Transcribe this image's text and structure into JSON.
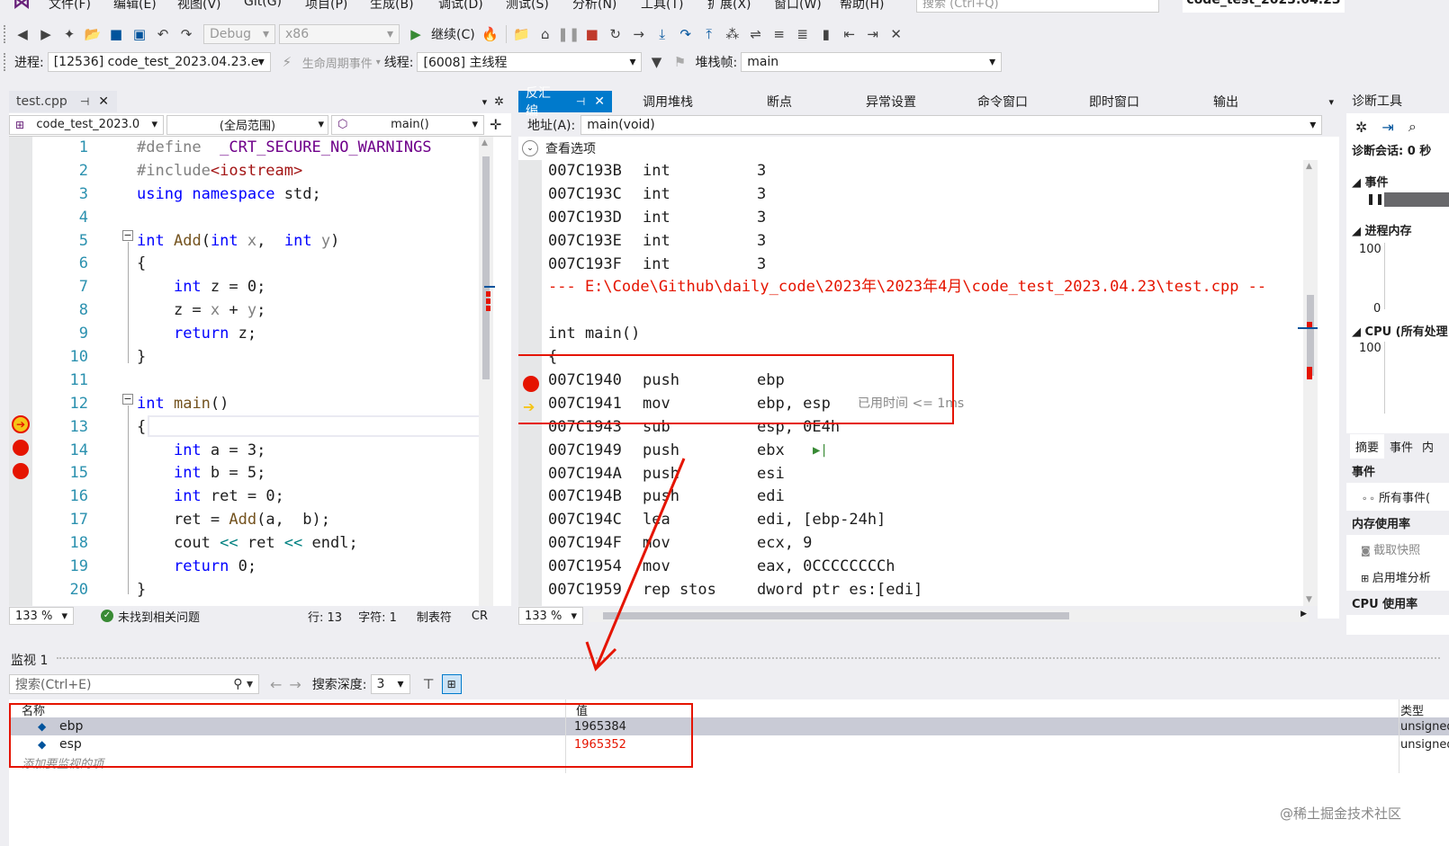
{
  "menubar": {
    "items": [
      "文件(F)",
      "编辑(E)",
      "视图(V)",
      "Git(G)",
      "项目(P)",
      "生成(B)",
      "调试(D)",
      "测试(S)",
      "分析(N)",
      "工具(T)",
      "扩展(X)",
      "窗口(W)",
      "帮助(H)"
    ],
    "search_placeholder": "搜索 (Ctrl+Q)",
    "window_title": "code_test_2023.04.23"
  },
  "toolbar1": {
    "config": "Debug",
    "platform": "x86",
    "continue_label": "继续(C)"
  },
  "toolbar2": {
    "process_label": "进程:",
    "process_value": "[12536] code_test_2023.04.23.e",
    "lifecycle_label": "生命周期事件",
    "thread_label": "线程:",
    "thread_value": "[6008] 主线程",
    "stackframe_label": "堆栈帧:",
    "stackframe_value": "main"
  },
  "editor": {
    "tab_label": "test.cpp",
    "project_combo": "code_test_2023.0",
    "scope_combo": "(全局范围)",
    "func_combo": "main()",
    "zoom": "133 %",
    "status_text": "未找到相关问题",
    "line_status": "行: 13",
    "char_status": "字符: 1",
    "tab_status": "制表符",
    "crlf_status": "CR",
    "line_numbers": [
      "1",
      "2",
      "3",
      "4",
      "5",
      "6",
      "7",
      "8",
      "9",
      "10",
      "11",
      "12",
      "13",
      "14",
      "15",
      "16",
      "17",
      "18",
      "19",
      "20"
    ]
  },
  "disasm": {
    "tabs": [
      "反汇编",
      "调用堆栈",
      "断点",
      "异常设置",
      "命令窗口",
      "即时窗口",
      "输出"
    ],
    "address_label": "地址(A):",
    "address_value": "main(void)",
    "view_options": "查看选项",
    "zoom": "133 %",
    "elapsed": "已用时间 <= 1ms",
    "source_path": "--- E:\\Code\\Github\\daily_code\\2023年\\2023年4月\\code_test_2023.04.23\\test.cpp --",
    "src_main": "int main()",
    "src_brace": "{",
    "top_lines": [
      {
        "addr": "007C193B",
        "op": "int",
        "arg": "3"
      },
      {
        "addr": "007C193C",
        "op": "int",
        "arg": "3"
      },
      {
        "addr": "007C193D",
        "op": "int",
        "arg": "3"
      },
      {
        "addr": "007C193E",
        "op": "int",
        "arg": "3"
      },
      {
        "addr": "007C193F",
        "op": "int",
        "arg": "3"
      }
    ],
    "main_lines": [
      {
        "addr": "007C1940",
        "op": "push",
        "arg": "ebp"
      },
      {
        "addr": "007C1941",
        "op": "mov",
        "arg": "ebp, esp"
      },
      {
        "addr": "007C1943",
        "op": "sub",
        "arg": "esp, 0E4h"
      },
      {
        "addr": "007C1949",
        "op": "push",
        "arg": "ebx"
      },
      {
        "addr": "007C194A",
        "op": "push",
        "arg": "esi"
      },
      {
        "addr": "007C194B",
        "op": "push",
        "arg": "edi"
      },
      {
        "addr": "007C194C",
        "op": "lea",
        "arg": "edi, [ebp-24h]"
      },
      {
        "addr": "007C194F",
        "op": "mov",
        "arg": "ecx, 9"
      },
      {
        "addr": "007C1954",
        "op": "mov",
        "arg": "eax, 0CCCCCCCCh"
      },
      {
        "addr": "007C1959",
        "op": "rep stos",
        "arg": "dword ptr es:[edi]"
      }
    ]
  },
  "diag": {
    "title": "诊断工具",
    "session": "诊断会话: 0 秒",
    "events_head": "事件",
    "memory_head": "进程内存",
    "mem_max": "100",
    "mem_min": "0",
    "cpu_head": "CPU (所有处理",
    "cpu_max": "100",
    "tabs": [
      "摘要",
      "事件",
      "内"
    ],
    "section_events": "事件",
    "all_events": "所有事件(",
    "section_mem": "内存使用率",
    "snapshot": "截取快照",
    "heap": "启用堆分析",
    "section_cpu": "CPU 使用率"
  },
  "watch": {
    "title": "监视 1",
    "search_placeholder": "搜索(Ctrl+E)",
    "depth_label": "搜索深度:",
    "depth_value": "3",
    "col_name": "名称",
    "col_value": "值",
    "col_type": "类型",
    "rows": [
      {
        "name": "ebp",
        "value": "1965384",
        "type": "unsigned"
      },
      {
        "name": "esp",
        "value": "1965352",
        "type": "unsigned"
      }
    ],
    "add_hint": "添加要监视的项"
  },
  "watermark": "@稀土掘金技术社区",
  "colors": {
    "accent": "#007acc",
    "breakpoint": "#e51400",
    "changed_value": "#e51400"
  }
}
